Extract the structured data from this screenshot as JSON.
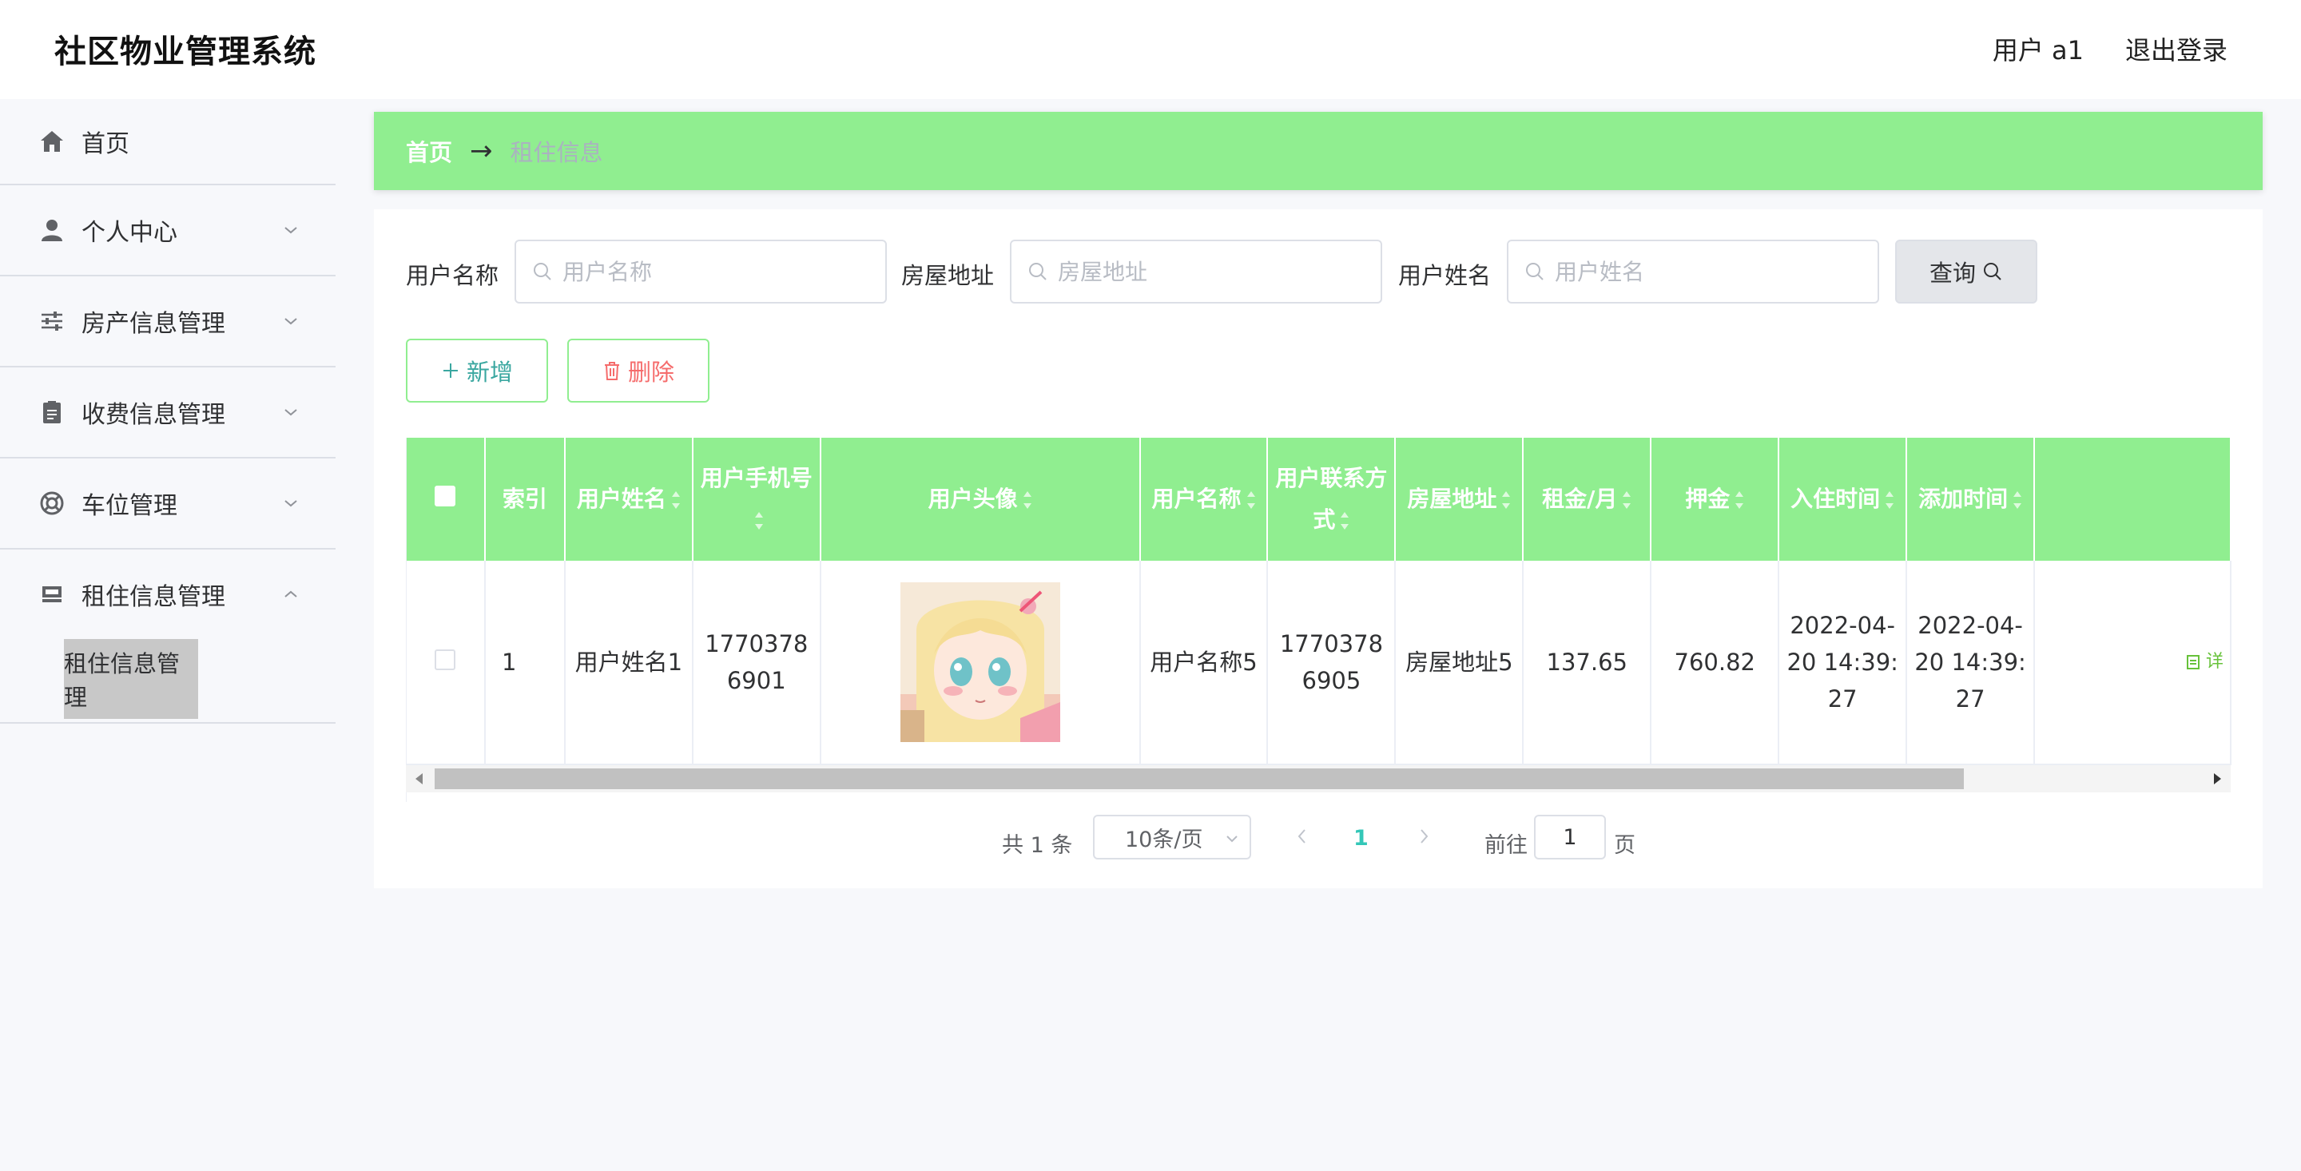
{
  "header": {
    "title": "社区物业管理系统",
    "user": "用户 a1",
    "logout": "退出登录"
  },
  "sidebar": {
    "items": [
      {
        "label": "首页",
        "icon": "home-icon"
      },
      {
        "label": "个人中心",
        "icon": "user-icon"
      },
      {
        "label": "房产信息管理",
        "icon": "sliders-icon"
      },
      {
        "label": "收费信息管理",
        "icon": "clipboard-icon"
      },
      {
        "label": "车位管理",
        "icon": "lifebuoy-icon"
      },
      {
        "label": "租住信息管理",
        "icon": "tray-icon"
      }
    ],
    "active_submenu": "租住信息管理"
  },
  "breadcrumb": {
    "home": "首页",
    "separator": "→",
    "current": "租住信息"
  },
  "search": {
    "fields": [
      {
        "label": "用户名称",
        "placeholder": "用户名称"
      },
      {
        "label": "房屋地址",
        "placeholder": "房屋地址"
      },
      {
        "label": "用户姓名",
        "placeholder": "用户姓名"
      }
    ],
    "query_button": "查询"
  },
  "actions": {
    "add": "新增",
    "delete": "删除"
  },
  "table": {
    "columns": [
      "索引",
      "用户姓名",
      "用户手机号",
      "用户头像",
      "用户名称",
      "用户联系方式",
      "房屋地址",
      "租金/月",
      "押金",
      "入住时间",
      "添加时间"
    ],
    "rows": [
      {
        "index": "1",
        "user_realname": "用户姓名1",
        "user_phone": "17703786901",
        "user_name": "用户名称5",
        "contact": "17703786905",
        "address": "房屋地址5",
        "rent": "137.65",
        "deposit": "760.82",
        "checkin_time": "2022-04-20 14:39:27",
        "added_time": "2022-04-20 14:39:27",
        "op_detail": "详"
      }
    ]
  },
  "pagination": {
    "total": "共 1 条",
    "page_size": "10条/页",
    "current_page": "1",
    "goto_label": "前往",
    "goto_value": "1",
    "page_unit": "页"
  },
  "colors": {
    "accent_green": "#90ee90",
    "delete_red": "#f56c6c",
    "page_teal": "#34c7b8",
    "background": "#f7f8fb"
  }
}
